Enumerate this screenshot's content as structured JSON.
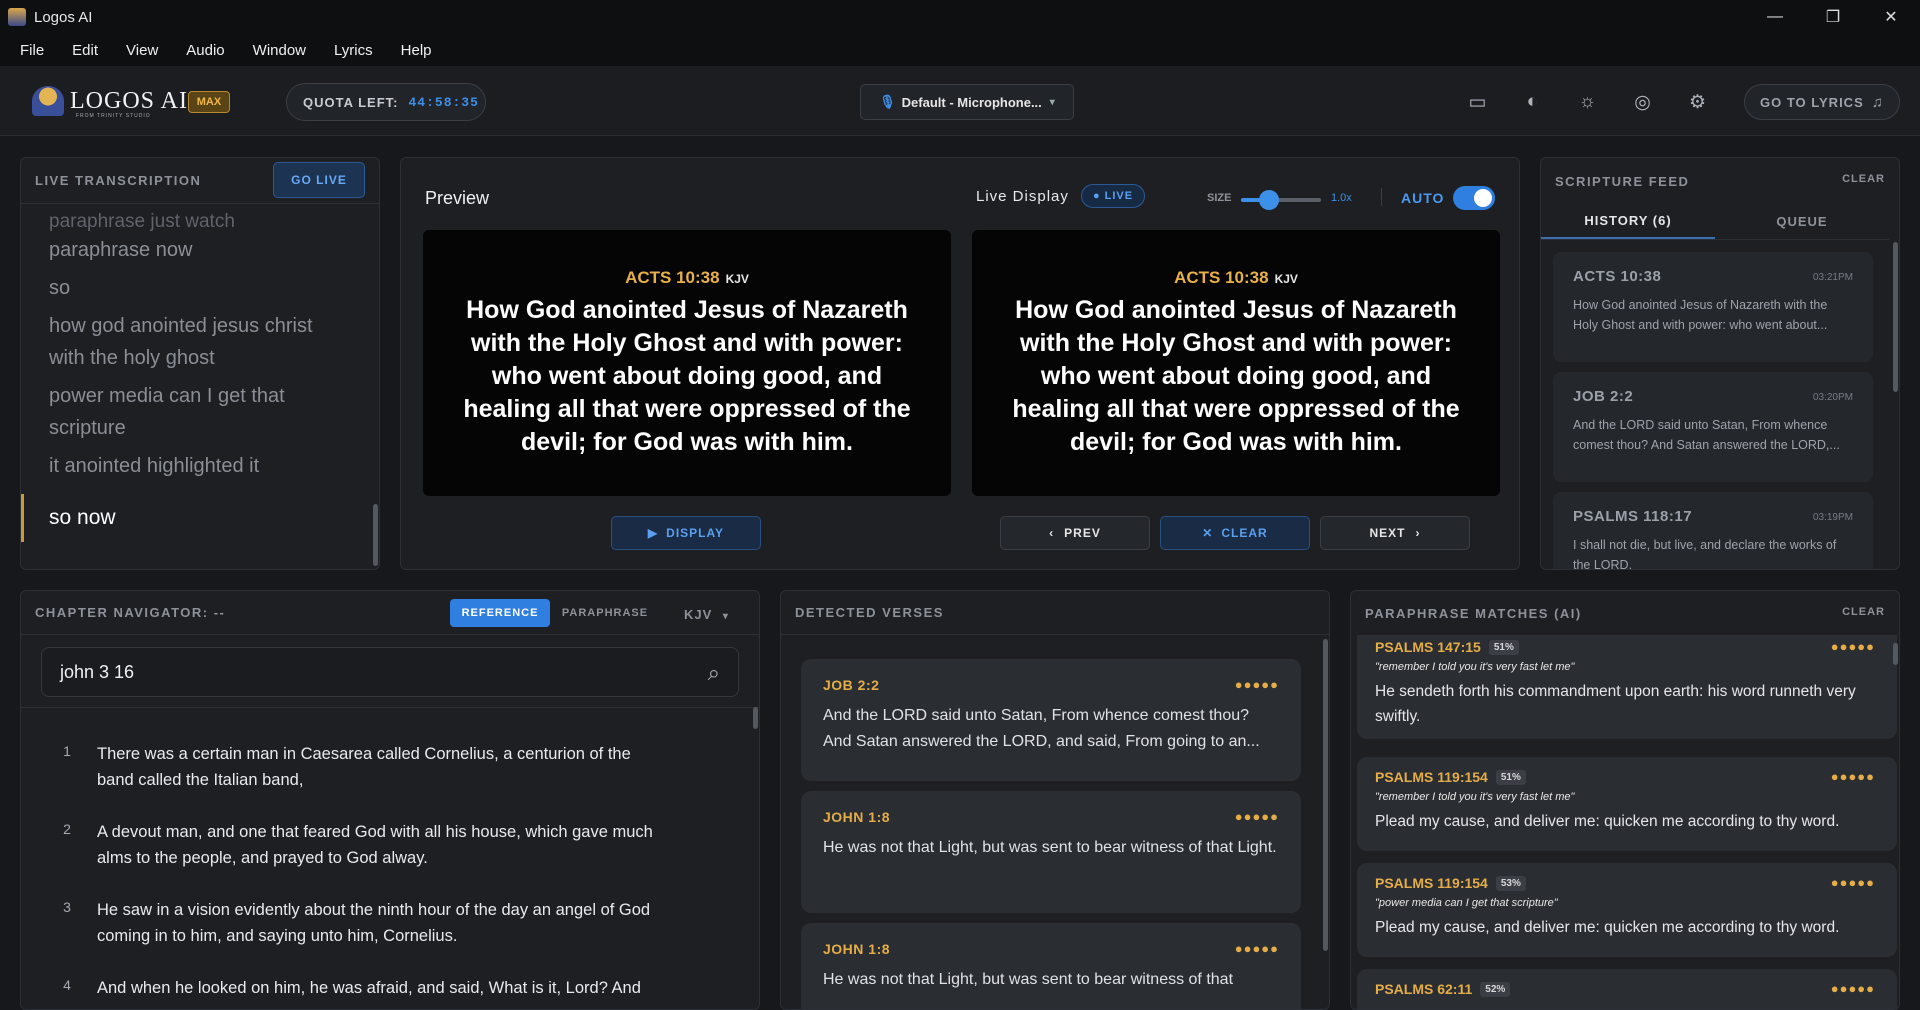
{
  "window": {
    "title": "Logos AI",
    "controls": [
      "—",
      "❐",
      "✕"
    ]
  },
  "menu": [
    "File",
    "Edit",
    "View",
    "Audio",
    "Window",
    "Lyrics",
    "Help"
  ],
  "topbar": {
    "logo_text": "LOGOS AI",
    "logo_subtext": "FROM TRINITY STUDIO",
    "plan_badge": "MAX",
    "quota_label": "QUOTA LEFT:",
    "quota_value": "44:58:35",
    "mic_label": "Default - Microphone...",
    "icons": [
      "monitor-icon",
      "palette-icon",
      "sun-icon",
      "compass-icon",
      "gear-icon"
    ],
    "goto_lyrics": "GO TO LYRICS"
  },
  "transcription": {
    "title": "LIVE TRANSCRIPTION",
    "go_live": "GO LIVE",
    "lines": [
      "paraphrase just watch",
      "paraphrase now",
      "so",
      "how god anointed jesus christ",
      "with the holy ghost",
      "power media can I get that",
      "scripture",
      "it anointed highlighted it"
    ],
    "current": "so now"
  },
  "preview": {
    "title": "Preview",
    "live_display_label": "Live Display",
    "live_pill": "LIVE",
    "size_label": "SIZE",
    "size_value": "1.0x",
    "size_fraction": 0.35,
    "auto_label": "AUTO",
    "auto_on": true,
    "reference": "ACTS 10:38",
    "version": "KJV",
    "text": "How God anointed Jesus of Nazareth with the Holy Ghost and with power: who went about doing good, and healing all that were oppressed of the devil; for God was with him.",
    "live_reference": "ACTS 10:38",
    "live_version": "KJV",
    "live_text": "How God anointed Jesus of Nazareth with the Holy Ghost and with power: who went about doing good, and healing all that were oppressed of the devil; for God was with him.",
    "display_btn": "DISPLAY",
    "prev_btn": "PREV",
    "clear_btn": "CLEAR",
    "next_btn": "NEXT"
  },
  "feed": {
    "title": "SCRIPTURE FEED",
    "clear": "CLEAR",
    "tab_history": "HISTORY (6)",
    "tab_queue": "QUEUE",
    "items": [
      {
        "ref": "ACTS 10:38",
        "time": "03:21PM",
        "text": "How God anointed Jesus of Nazareth with the Holy Ghost and with power: who went about..."
      },
      {
        "ref": "JOB 2:2",
        "time": "03:20PM",
        "text": "And the LORD said unto Satan, From whence comest thou? And Satan answered the LORD,..."
      },
      {
        "ref": "PSALMS 118:17",
        "time": "03:19PM",
        "text": "I shall not die, but live, and declare the works of the LORD."
      }
    ]
  },
  "navigator": {
    "title": "CHAPTER NAVIGATOR: --",
    "tab_reference": "REFERENCE",
    "tab_paraphrase": "PARAPHRASE",
    "version": "KJV",
    "search_value": "john 3 16",
    "verses": [
      {
        "n": "1",
        "text": "There was a certain man in Caesarea called Cornelius, a centurion of the band called the Italian band,"
      },
      {
        "n": "2",
        "text": "A devout man, and one that feared God with all his house, which gave much alms to the people, and prayed to God alway."
      },
      {
        "n": "3",
        "text": "He saw in a vision evidently about the ninth hour of the day an angel of God coming in to him, and saying unto him, Cornelius."
      },
      {
        "n": "4",
        "text": "And when he looked on him, he was afraid, and said, What is it, Lord? And"
      }
    ]
  },
  "detected": {
    "title": "DETECTED VERSES",
    "items": [
      {
        "ref": "JOB 2:2",
        "dots": "●●●●●",
        "text": "And the LORD said unto Satan, From whence comest thou? And Satan answered the LORD, and said, From going to an..."
      },
      {
        "ref": "JOHN 1:8",
        "dots": "●●●●●",
        "text": "He was not that Light, but was sent to bear witness of that Light."
      },
      {
        "ref": "JOHN 1:8",
        "dots": "●●●●●",
        "text": "He was not that Light, but was sent to bear witness of that"
      }
    ]
  },
  "paraphrase": {
    "title": "PARAPHRASE MATCHES (AI)",
    "clear": "CLEAR",
    "items": [
      {
        "ref": "PSALMS 147:15",
        "pct": "51%",
        "dots": "●●●●●",
        "quote": "\"remember I told you it's very fast let me\"",
        "text": "He sendeth forth his commandment upon earth: his word runneth very swiftly."
      },
      {
        "ref": "PSALMS 119:154",
        "pct": "51%",
        "dots": "●●●●●",
        "quote": "\"remember I told you it's very fast let me\"",
        "text": "Plead my cause, and deliver me: quicken me according to thy word."
      },
      {
        "ref": "PSALMS 119:154",
        "pct": "53%",
        "dots": "●●●●●",
        "quote": "\"power media can I get that scripture\"",
        "text": "Plead my cause, and deliver me: quicken me according to thy word."
      },
      {
        "ref": "PSALMS 62:11",
        "pct": "52%",
        "dots": "●●●●●",
        "quote": "",
        "text": ""
      }
    ]
  }
}
